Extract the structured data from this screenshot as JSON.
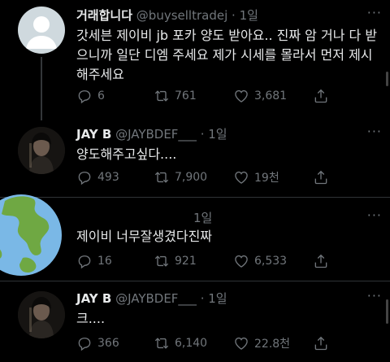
{
  "tweets": [
    {
      "name": "거래합니다",
      "handle": "@buyselltradej",
      "time": "· 1일",
      "text": "갓세븐 제이비 jb 포카 양도 받아요.. 진짜 암 거나 다 받으니까 일단 디엠 주세요 제가 시세를 몰라서 먼저 제시해주세요",
      "replies": "6",
      "retweets": "761",
      "likes": "3,681"
    },
    {
      "name": "JAY B",
      "handle": "@JAYBDEF___",
      "time": "· 1일",
      "text": "양도해주고싶다....",
      "replies": "493",
      "retweets": "7,900",
      "likes": "19천"
    },
    {
      "name": "",
      "handle": "",
      "time": "1일",
      "text": "제이비 너무잘생겼다진짜",
      "replies": "16",
      "retweets": "921",
      "likes": "6,533"
    },
    {
      "name": "JAY B",
      "handle": "@JAYBDEF___",
      "time": "· 1일",
      "text": "크....",
      "replies": "366",
      "retweets": "6,140",
      "likes": "22.8천"
    }
  ],
  "icons": {
    "more": "more-icon",
    "reply": "reply-icon",
    "retweet": "retweet-icon",
    "like": "heart-icon",
    "share": "share-icon"
  },
  "colors": {
    "background": "#000000",
    "text": "#e7e9ea",
    "muted": "#71767b",
    "divider": "#2f3336",
    "globe_ocean": "#7ab8e6",
    "globe_land": "#6fa843"
  }
}
